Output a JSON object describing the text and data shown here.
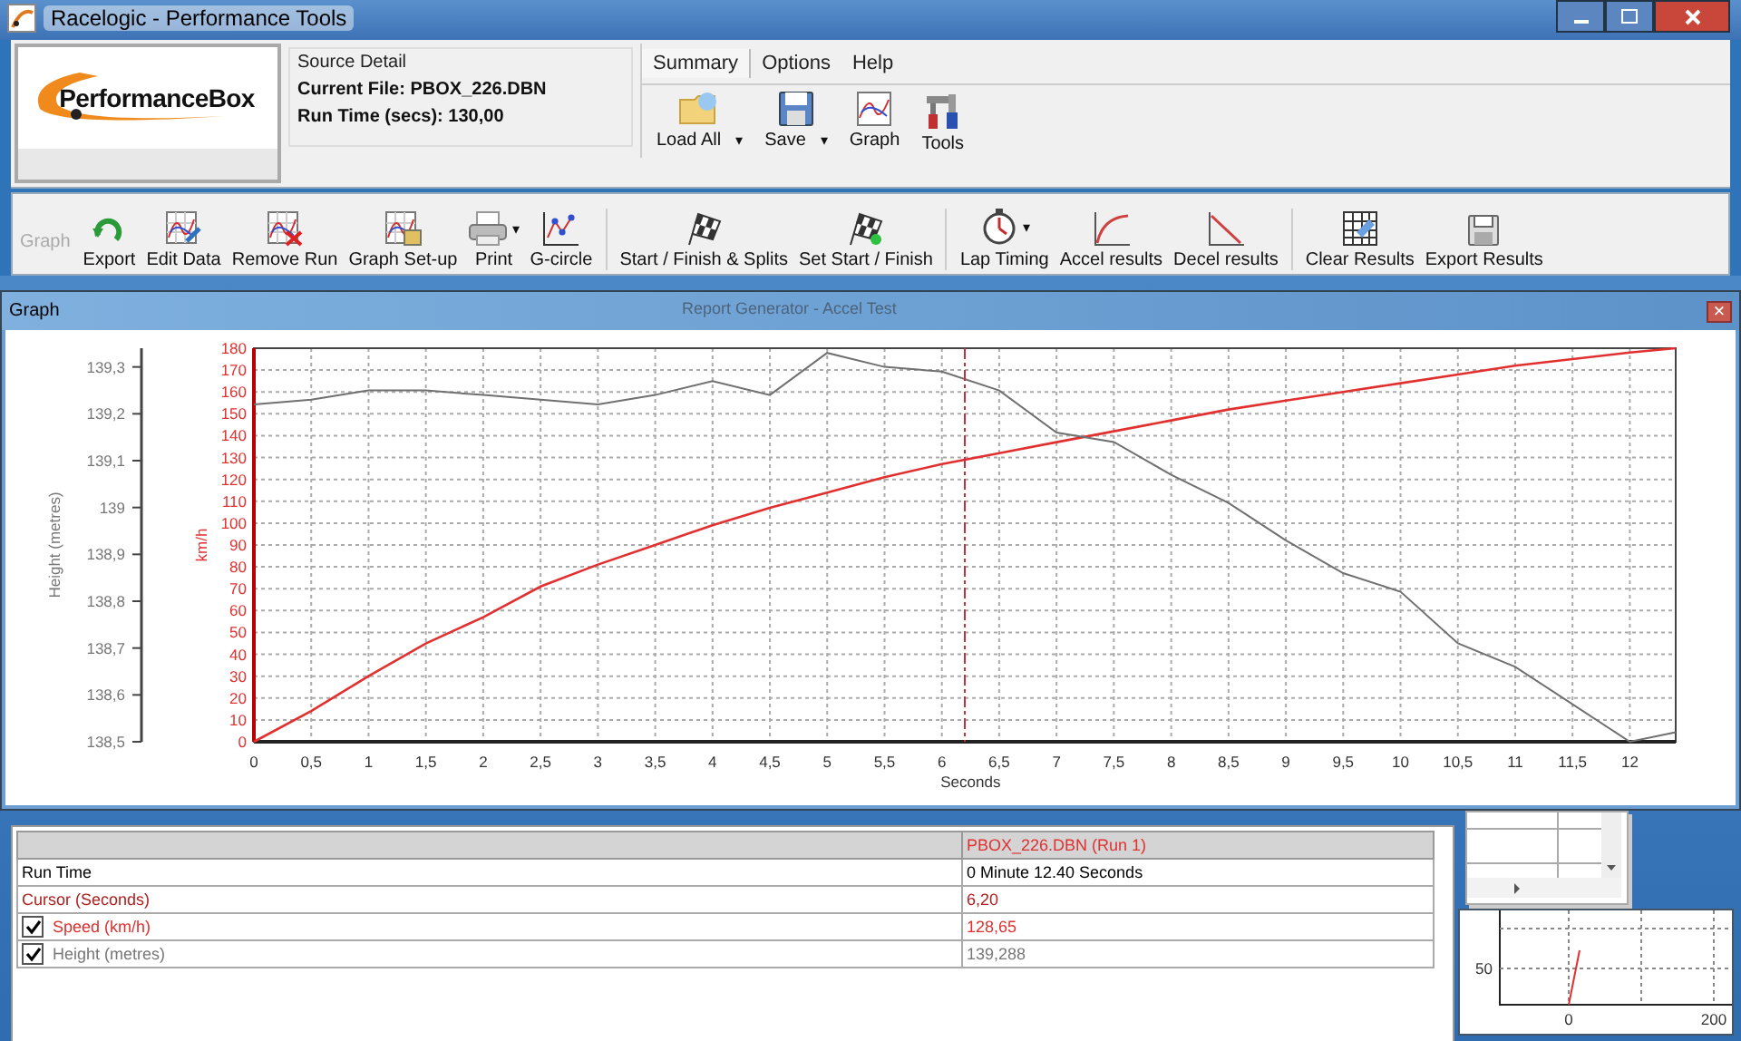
{
  "window": {
    "title": "Racelogic - Performance Tools"
  },
  "logo": {
    "text": "PerformanceBox"
  },
  "source_detail": {
    "title": "Source Detail",
    "current_file": "Current File: PBOX_226.DBN",
    "run_time": "Run Time (secs): 130,00"
  },
  "menu": [
    {
      "label": "Summary",
      "selected": true
    },
    {
      "label": "Options",
      "selected": false
    },
    {
      "label": "Help",
      "selected": false
    }
  ],
  "ribbon_buttons": [
    {
      "label": "Load All",
      "caret": "▾"
    },
    {
      "label": "Save",
      "caret": "▾"
    },
    {
      "label": "Graph"
    },
    {
      "label": "Tools"
    }
  ],
  "toolbar": {
    "group_label": "Graph",
    "groups": [
      [
        {
          "label": "Export"
        },
        {
          "label": "Edit Data"
        },
        {
          "label": "Remove Run"
        },
        {
          "label": "Graph Set-up"
        },
        {
          "label": "Print",
          "caret": "▾"
        },
        {
          "label": "G-circle"
        }
      ],
      [
        {
          "label": "Start / Finish & Splits"
        },
        {
          "label": "Set Start / Finish"
        }
      ],
      [
        {
          "label": "Lap Timing",
          "caret": "▾"
        },
        {
          "label": "Accel results"
        },
        {
          "label": "Decel results"
        }
      ],
      [
        {
          "label": "Clear Results"
        },
        {
          "label": "Export Results"
        }
      ]
    ]
  },
  "background_window": {
    "title": "Report Generator - Accel Test"
  },
  "graph_window": {
    "title": "Graph",
    "close": "×",
    "chart_data": {
      "type": "line",
      "xlabel": "Seconds",
      "ylabel": "km/h",
      "y2label": "Height (metres)",
      "xlim": [
        0,
        12.4
      ],
      "ylim": [
        0,
        180
      ],
      "y2lim": [
        138.5,
        139.34
      ],
      "grid": true,
      "ref_lines": [
        {
          "axis": "x",
          "value": 6.2,
          "color": "#c03040"
        }
      ],
      "x": [
        0,
        0.5,
        1,
        1.5,
        2,
        2.5,
        3,
        3.5,
        4,
        4.5,
        5,
        5.5,
        6,
        6.5,
        7,
        7.5,
        8,
        8.5,
        9,
        9.5,
        10,
        10.5,
        11,
        11.5,
        12,
        12.4
      ],
      "series": [
        {
          "color": "#e03030",
          "axis": "y",
          "values": [
            0,
            14,
            30,
            45,
            57,
            71,
            81,
            90,
            99,
            107,
            114,
            121,
            127,
            132,
            137,
            142,
            147,
            152,
            156,
            160,
            164,
            168,
            172,
            175,
            178,
            180
          ]
        },
        {
          "color": "#707070",
          "axis": "y2",
          "values": [
            139.22,
            139.23,
            139.25,
            139.25,
            139.24,
            139.23,
            139.22,
            139.24,
            139.27,
            139.24,
            139.33,
            139.3,
            139.29,
            139.25,
            139.16,
            139.14,
            139.07,
            139.01,
            138.93,
            138.86,
            138.82,
            138.71,
            138.66,
            138.58,
            138.5,
            138.52
          ]
        }
      ],
      "xticks": [
        {
          "value": 0,
          "label": "0"
        },
        {
          "value": 0.5,
          "label": "0,5"
        },
        {
          "value": 1,
          "label": "1"
        },
        {
          "value": 1.5,
          "label": "1,5"
        },
        {
          "value": 2,
          "label": "2"
        },
        {
          "value": 2.5,
          "label": "2,5"
        },
        {
          "value": 3,
          "label": "3"
        },
        {
          "value": 3.5,
          "label": "3,5"
        },
        {
          "value": 4,
          "label": "4"
        },
        {
          "value": 4.5,
          "label": "4,5"
        },
        {
          "value": 5,
          "label": "5"
        },
        {
          "value": 5.5,
          "label": "5,5"
        },
        {
          "value": 6,
          "label": "6"
        },
        {
          "value": 6.5,
          "label": "6,5"
        },
        {
          "value": 7,
          "label": "7"
        },
        {
          "value": 7.5,
          "label": "7,5"
        },
        {
          "value": 8,
          "label": "8"
        },
        {
          "value": 8.5,
          "label": "8,5"
        },
        {
          "value": 9,
          "label": "9"
        },
        {
          "value": 9.5,
          "label": "9,5"
        },
        {
          "value": 10,
          "label": "10"
        },
        {
          "value": 10.5,
          "label": "10,5"
        },
        {
          "value": 11,
          "label": "11"
        },
        {
          "value": 11.5,
          "label": "11,5"
        },
        {
          "value": 12,
          "label": "12"
        }
      ],
      "yticks": [
        0,
        10,
        20,
        30,
        40,
        50,
        60,
        70,
        80,
        90,
        100,
        110,
        120,
        130,
        140,
        150,
        160,
        170,
        180
      ],
      "y2ticks": [
        {
          "value": 138.5,
          "label": "138,5"
        },
        {
          "value": 138.6,
          "label": "138,6"
        },
        {
          "value": 138.7,
          "label": "138,7"
        },
        {
          "value": 138.8,
          "label": "138,8"
        },
        {
          "value": 138.9,
          "label": "138,9"
        },
        {
          "value": 139,
          "label": "139"
        },
        {
          "value": 139.1,
          "label": "139,1"
        },
        {
          "value": 139.2,
          "label": "139,2"
        },
        {
          "value": 139.3,
          "label": "139,3"
        }
      ]
    }
  },
  "results_table": {
    "columns": [
      "PBOX_226.DBN (Run 1)"
    ],
    "rows": [
      {
        "label": "Run Time",
        "value": "0 Minute 12.40 Seconds",
        "color": "#000000"
      },
      {
        "label": "Cursor (Seconds)",
        "value": "6,20",
        "color": "#b02020"
      },
      {
        "label": "Speed (km/h)",
        "value": "128,65",
        "color": "#e03030",
        "checked": true
      },
      {
        "label": "Height (metres)",
        "value": "139,288",
        "color": "#777777",
        "checked": true
      }
    ]
  },
  "mini_chart": {
    "yticks": [
      "50"
    ],
    "xticks": [
      "0",
      "200"
    ]
  }
}
